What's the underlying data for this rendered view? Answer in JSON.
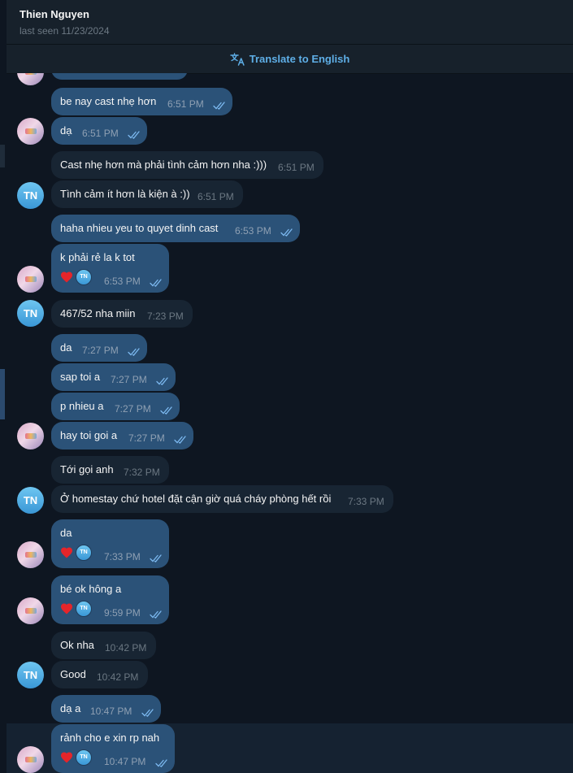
{
  "header": {
    "name": "Thien Nguyen",
    "status": "last seen 11/23/2024"
  },
  "translate": {
    "label": "Translate to English"
  },
  "avatar_initials": "TN",
  "messages": [
    {
      "text": "be nay cast nhẹ hơn",
      "time": "6:51 PM"
    },
    {
      "text": "dạ",
      "time": "6:51 PM"
    },
    {
      "text": "Cast nhẹ hơn mà phải tình cảm hơn nha :)))",
      "time": "6:51 PM"
    },
    {
      "text": "Tình cảm ít hơn là kiện à :))",
      "time": "6:51 PM"
    },
    {
      "text": "haha nhieu yeu to quyet dinh cast",
      "time": "6:53 PM"
    },
    {
      "text": "k phải rẻ la k tot",
      "time": "6:53 PM"
    },
    {
      "text": "467/52 nha miin",
      "time": "7:23 PM"
    },
    {
      "text": "da",
      "time": "7:27 PM"
    },
    {
      "text": "sap toi a",
      "time": "7:27 PM"
    },
    {
      "text": "p nhieu a",
      "time": "7:27 PM"
    },
    {
      "text": "hay toi goi a",
      "time": "7:27 PM"
    },
    {
      "text": "Tới gọi anh",
      "time": "7:32 PM"
    },
    {
      "text": "Ở homestay chứ hotel đặt cận giờ quá cháy phòng hết rồi",
      "time": "7:33 PM"
    },
    {
      "text": "da",
      "time": "7:33 PM"
    },
    {
      "text": "bé ok hông a",
      "time": "9:59 PM"
    },
    {
      "text": "Ok nha",
      "time": "10:42 PM"
    },
    {
      "text": "Good",
      "time": "10:42 PM"
    },
    {
      "text": "dạ a",
      "time": "10:47 PM"
    },
    {
      "text": "rảnh cho e xin rp nah",
      "time": "10:47 PM"
    }
  ],
  "colors": {
    "background": "#0e1621",
    "header": "#17212b",
    "outgoing_bubble": "#2b5278",
    "incoming_bubble": "#182533",
    "accent": "#5eaee6",
    "reaction_heart": "#e5252a"
  }
}
